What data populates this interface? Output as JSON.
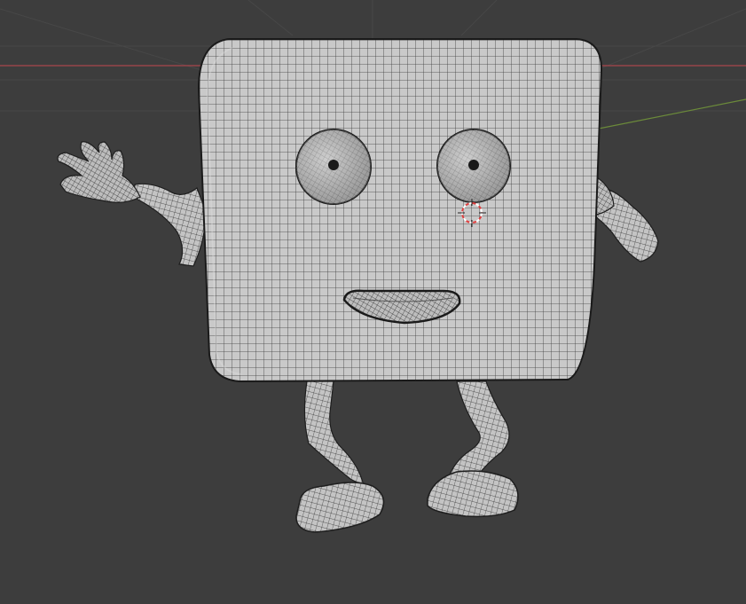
{
  "viewport": {
    "background_color": "#3d3d3d",
    "mode": "wireframe-overlay",
    "grid": true,
    "axes": {
      "x_axis_color": "#a8454d",
      "y_axis_color": "#6b8a3a"
    }
  },
  "model": {
    "shading_color": "#c9c9c9",
    "wire_color": "#2a2a2a",
    "parts": [
      "body",
      "left-eye",
      "right-eye",
      "mouth",
      "left-arm",
      "right-arm",
      "left-hand",
      "right-hand",
      "left-leg",
      "right-leg",
      "left-foot",
      "right-foot"
    ]
  },
  "cursor_3d": {
    "icon": "3d-cursor-icon",
    "colors": [
      "#e04040",
      "#ffffff"
    ]
  }
}
